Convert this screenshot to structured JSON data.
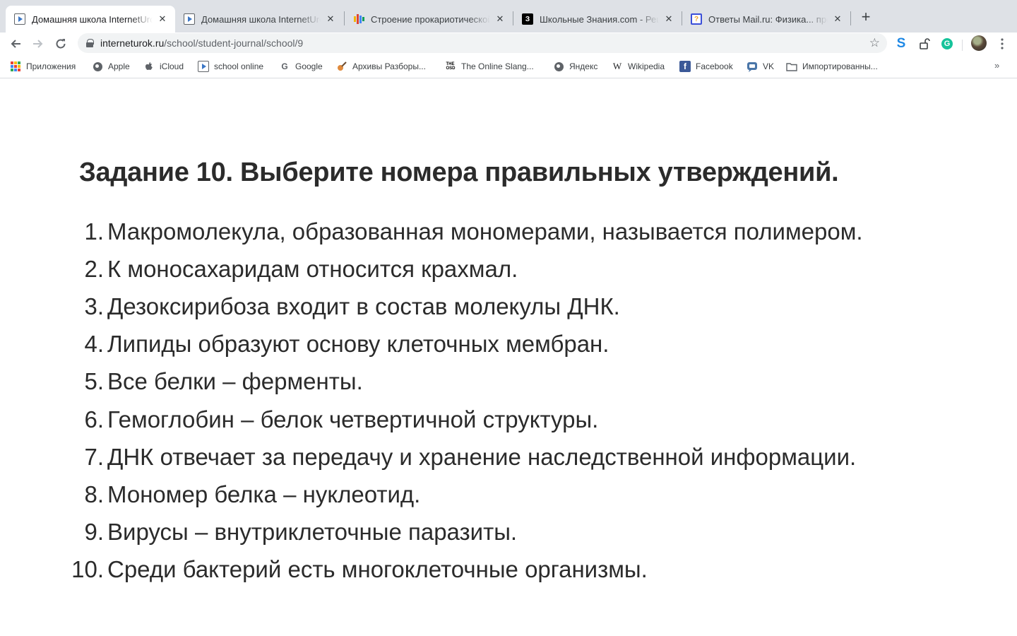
{
  "browser": {
    "tabs": [
      {
        "title": "Домашняя школа InternetUrok",
        "favicon": "video-play-icon",
        "active": true
      },
      {
        "title": "Домашняя школа InternetUrok",
        "favicon": "video-play-icon",
        "active": false
      },
      {
        "title": "Строение прокариотической",
        "favicon": "bar-chart-icon",
        "active": false
      },
      {
        "title": "Школьные Знания.com - Реш",
        "favicon": "znanija-icon",
        "active": false
      },
      {
        "title": "Ответы Mail.ru: Физика... про",
        "favicon": "question-icon",
        "active": false
      }
    ],
    "address_bar": {
      "host": "interneturok.ru",
      "path": "/school/student-journal/school/9"
    },
    "bookmarks": [
      {
        "label": "Приложения",
        "icon": "apps-grid-icon"
      },
      {
        "label": "Apple",
        "icon": "globe-icon"
      },
      {
        "label": "iCloud",
        "icon": "apple-icon"
      },
      {
        "label": "school online",
        "icon": "video-play-icon"
      },
      {
        "label": "Google",
        "icon": "google-icon"
      },
      {
        "label": "Архивы Разборы...",
        "icon": "guitar-icon"
      },
      {
        "label": "The Online Slang...",
        "icon": "slang-dictionary-icon"
      },
      {
        "label": "Яндекс",
        "icon": "globe-icon"
      },
      {
        "label": "Wikipedia",
        "icon": "wikipedia-icon"
      },
      {
        "label": "Facebook",
        "icon": "facebook-icon"
      },
      {
        "label": "VK",
        "icon": "vk-icon"
      },
      {
        "label": "Импортированны...",
        "icon": "folder-icon"
      }
    ],
    "colors": {
      "tabstrip": "#dee1e6",
      "omnibox": "#f1f3f4",
      "accent_blue": "#1a73e8",
      "facebook": "#3b5998",
      "grammarly": "#15c39a"
    }
  },
  "page": {
    "task_title": "Задание 10. Выберите номера правильных утверждений.",
    "statements": [
      {
        "num": "1.",
        "text": "Макромолекула, образованная мономерами, называется полимером."
      },
      {
        "num": "2.",
        "text": "К моносахаридам относится крахмал."
      },
      {
        "num": "3.",
        "text": "Дезоксирибоза входит в состав молекулы ДНК."
      },
      {
        "num": "4.",
        "text": "Липиды образуют основу клеточных мембран."
      },
      {
        "num": "5.",
        "text": "Все белки – ферменты."
      },
      {
        "num": "6.",
        "text": "Гемоглобин – белок четвертичной структуры."
      },
      {
        "num": "7.",
        "text": "ДНК отвечает за передачу и хранение наследственной информации."
      },
      {
        "num": "8.",
        "text": "Мономер белка – нуклеотид."
      },
      {
        "num": "9.",
        "text": "Вирусы – внутриклеточные паразиты."
      },
      {
        "num": "10.",
        "text": "Среди бактерий есть многоклеточные организмы."
      }
    ]
  }
}
